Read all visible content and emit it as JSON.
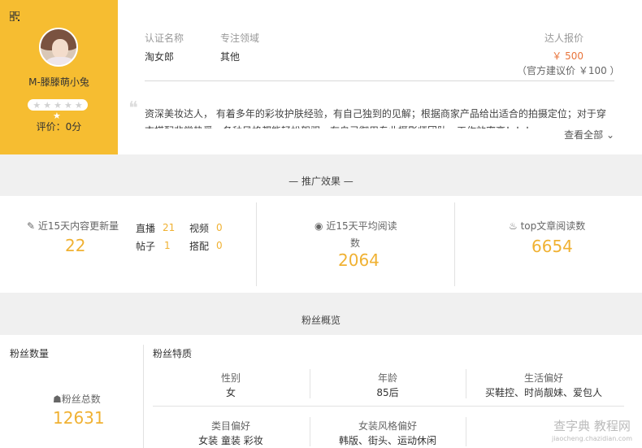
{
  "profile": {
    "name": "M-滕滕萌小兔",
    "rating_label": "评价：0分",
    "stars": 0
  },
  "info": {
    "cert_label": "认证名称",
    "cert_value": "淘女郎",
    "field_label": "专注领域",
    "field_value": "其他",
    "price_label": "达人报价",
    "price_value": "￥ 500",
    "suggest": "（官方建议价 ￥100 ）",
    "description": "资深美妆达人， 有着多年的彩妆护肤经验，有自己独到的见解；根据商家产品给出适合的拍摄定位；对于穿衣搭配非常热爱，各种风格都能轻松驾驭，有自己御用专业摄影师团队，工作效率高！！！",
    "more": "查看全部 ⌄"
  },
  "promo": {
    "title": "— 推广效果 —",
    "update_label": "近15天内容更新量",
    "update_value": "22",
    "live_label": "直播",
    "live_value": "21",
    "video_label": "视频",
    "video_value": "0",
    "post_label": "帖子",
    "post_value": "1",
    "match_label": "搭配",
    "match_value": "0",
    "avg_label_1": "近15天平均阅读",
    "avg_label_2": "数",
    "avg_value": "2064",
    "top_label": "top文章阅读数",
    "top_value": "6654"
  },
  "fans": {
    "title": "粉丝概览",
    "count_title": "粉丝数量",
    "total_label": "粉丝总数",
    "total_value": "12631",
    "traits_title": "粉丝特质",
    "gender_label": "性别",
    "gender_value": "女",
    "age_label": "年龄",
    "age_value": "85后",
    "life_label": "生活偏好",
    "life_value": "买鞋控、时尚靓妹、爱包人",
    "category_label": "类目偏好",
    "category_value": "女装 童装 彩妆",
    "style_label": "女装风格偏好",
    "style_value": "韩版、街头、运动休闲"
  },
  "watermark": {
    "main": "查字典 教程网",
    "sub": "jiaocheng.chazidian.com"
  },
  "colors": {
    "accent": "#f6bd31",
    "number": "#f0b132",
    "price": "#e8743b"
  }
}
